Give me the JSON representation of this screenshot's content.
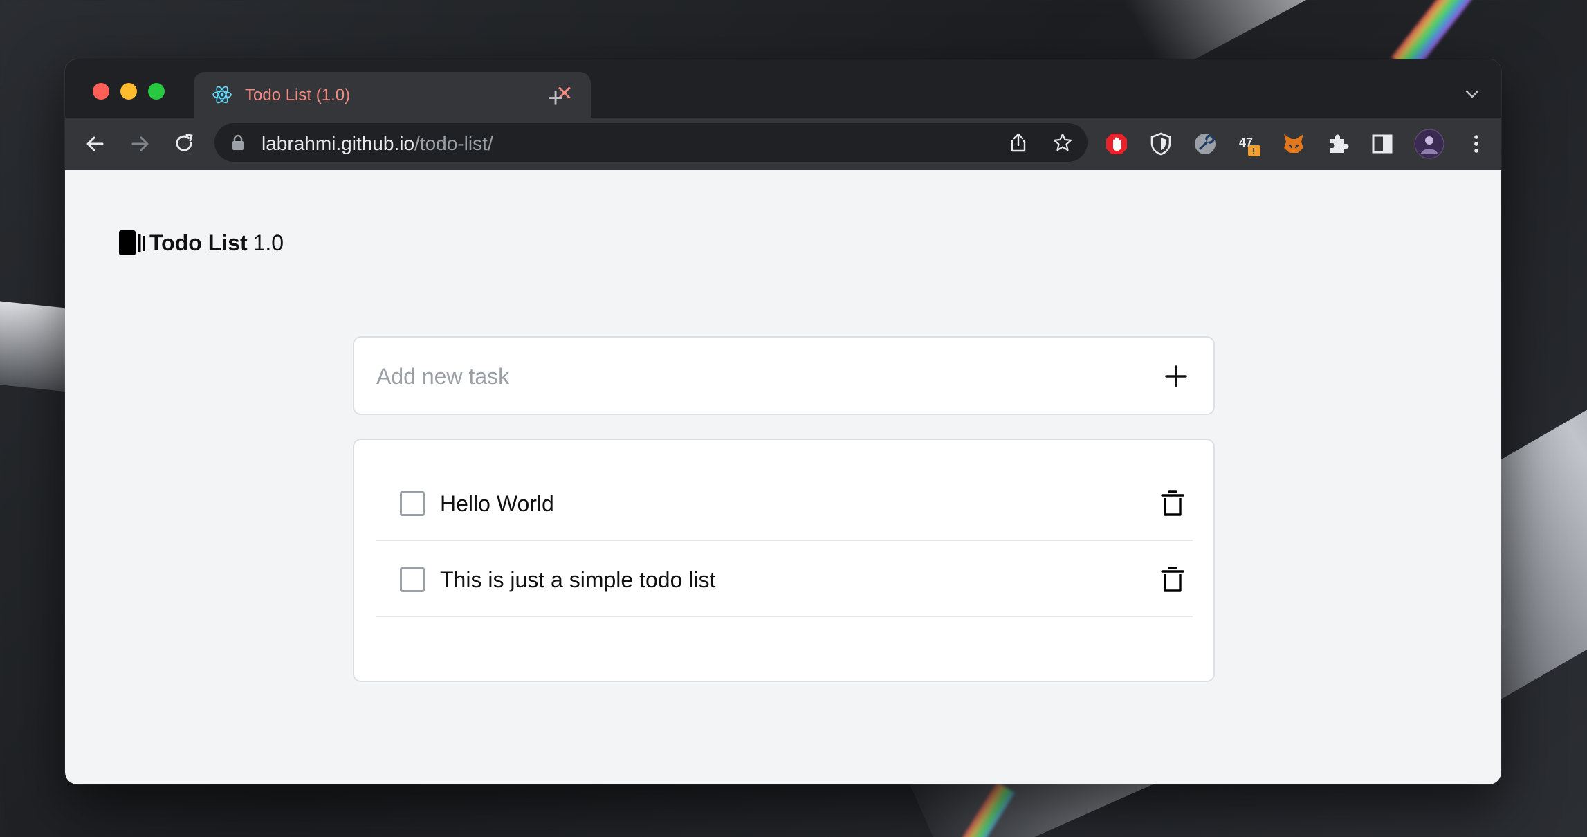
{
  "browser": {
    "tab": {
      "title": "Todo List (1.0)",
      "favicon": "react-icon",
      "close_symbol": "✕"
    },
    "new_tab_symbol": "+",
    "address": {
      "domain": "labrahmi.github.io",
      "path": "/todo-list/"
    },
    "extensions": [
      "adblock-icon",
      "shield-icon",
      "wrench-icon",
      "counter-extension-icon",
      "metamask-fox-icon",
      "puzzle-extensions-icon",
      "side-panel-icon",
      "profile-avatar",
      "more-menu-icon"
    ],
    "extension_badge": "!",
    "colors": {
      "frame": "#202124",
      "toolbar": "#35363a",
      "tab_text": "#f28b82"
    }
  },
  "app": {
    "brand_name": "Todo List",
    "brand_version": "1.0",
    "input": {
      "placeholder": "Add new task",
      "value": ""
    },
    "add_symbol": "+",
    "tasks": [
      {
        "text": "Hello World",
        "done": false
      },
      {
        "text": "This is just a simple todo list",
        "done": false
      }
    ],
    "colors": {
      "background": "#f3f4f6",
      "card": "#ffffff",
      "border": "#dcdfe4"
    }
  }
}
